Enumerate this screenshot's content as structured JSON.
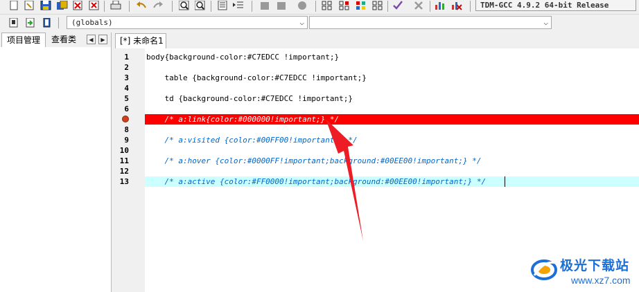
{
  "toolbar": {
    "compiler_selected": "TDM-GCC 4.9.2 64-bit Release",
    "scope_selected": "(globals)",
    "symbol_selected": ""
  },
  "left_panel": {
    "tabs": [
      "项目管理",
      "查看类"
    ],
    "nav_prev": "◀",
    "nav_next": "▶"
  },
  "editor": {
    "tab_title": "[*] 未命名1",
    "line_numbers": [
      "1",
      "2",
      "3",
      "4",
      "5",
      "6",
      "8",
      "9",
      "10",
      "11",
      "12",
      "13"
    ],
    "lines": [
      "body{background-color:#C7EDCC !important;}",
      "",
      "    table {background-color:#C7EDCC !important;}",
      "",
      "    td {background-color:#C7EDCC !important;}",
      "",
      "    /* a:link{color:#000000!important;} */",
      "    /* a:visited {color:#00FF00!important;} */",
      "",
      "    /* a:hover {color:#0000FF!important;background:#00EE00!important;} */",
      "",
      "    /* a:active {color:#FF0000!important;background:#00EE00!important;} */"
    ],
    "breakpoint_line": "7",
    "colors": {
      "breakpoint_line_bg": "#ff0000",
      "active_line_bg": "#ccffff",
      "comment": "#0066cc"
    }
  },
  "watermark": {
    "title": "极光下载站",
    "url": "www.xz7.com"
  }
}
